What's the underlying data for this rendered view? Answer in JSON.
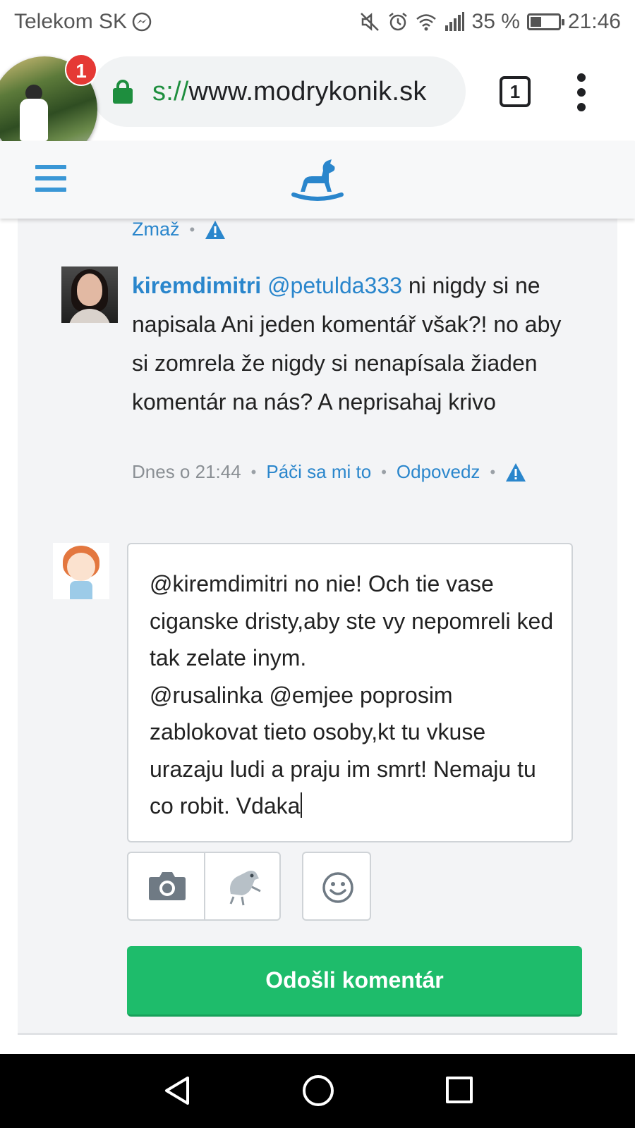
{
  "status_bar": {
    "carrier": "Telekom SK",
    "battery_text": "35 %",
    "battery_level": 0.35,
    "time": "21:46",
    "icons": [
      "messenger-icon",
      "mute-icon",
      "alarm-icon",
      "wifi-icon",
      "signal-icon",
      "battery-icon"
    ]
  },
  "browser": {
    "url_scheme": "s://",
    "url_host_prefix": "www.",
    "url_host": "modrykonik.sk",
    "tab_count": "1",
    "chat_badge": "1"
  },
  "colors": {
    "link_blue": "#2a86cc",
    "submit_green": "#1ebc6b",
    "secure_green": "#1e8e3e"
  },
  "previous_comment": {
    "delete_label": "Zmaž"
  },
  "comment": {
    "author": "kiremdimitri",
    "mention": "@petulda333",
    "text": " ni nigdy si ne napisala Ani jeden komentář však?! no aby si zomrela že nigdy si nenapísala žiaden komentár na nás? A neprisahaj krivo",
    "time": "Dnes o 21:44",
    "like_label": "Páči sa mi to",
    "reply_label": "Odpovedz"
  },
  "reply_form": {
    "text": "@kiremdimitri no nie! Och tie vase ciganske dristy,aby ste vy nepomreli ked tak zelate inym.\n@rusalinka @emjee poprosim zablokovat tieto osoby,kt tu vkuse urazaju ludi a praju im smrt! Nemaju tu co robit. Vdaka",
    "submit_label": "Odošli komentár"
  }
}
